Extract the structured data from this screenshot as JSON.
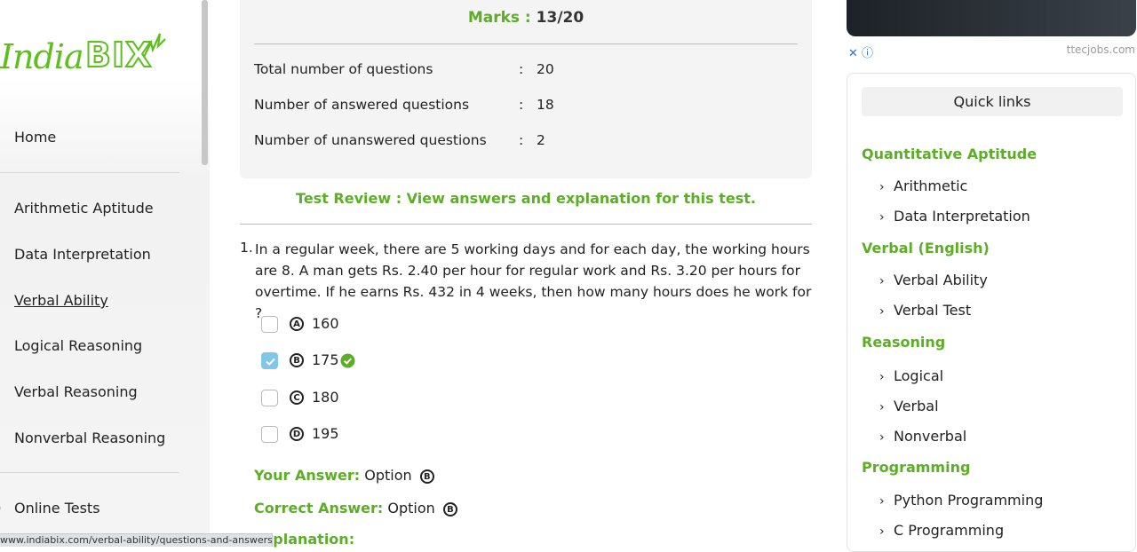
{
  "sidebar": {
    "logo": {
      "india": "India",
      "bix": "BIX"
    },
    "items": [
      {
        "label": "Home",
        "bullet": "·"
      },
      {
        "label": "Arithmetic Aptitude",
        "bullet": "|"
      },
      {
        "label": "Data Interpretation",
        "bullet": "|"
      },
      {
        "label": "Verbal Ability",
        "bullet": "!"
      },
      {
        "label": "Logical Reasoning",
        "bullet": "'"
      },
      {
        "label": "Verbal Reasoning",
        "bullet": ":"
      },
      {
        "label": "Nonverbal Reasoning",
        "bullet": "¦"
      },
      {
        "label": "Online Tests",
        "bullet": ")"
      }
    ],
    "status_url": "www.indiabix.com/verbal-ability/questions-and-answers/"
  },
  "result": {
    "marks_label": "Marks :",
    "marks_value": "13/20",
    "stats": [
      {
        "key": "Total number of questions",
        "colon": ":",
        "value": "20"
      },
      {
        "key": "Number of answered questions",
        "colon": ":",
        "value": "18"
      },
      {
        "key": "Number of unanswered questions",
        "colon": ":",
        "value": "2"
      }
    ]
  },
  "review_text": "Test Review : View answers and explanation for this test.",
  "question": {
    "number": "1.",
    "text": "In a regular week, there are 5 working days and for each day, the working hours are 8. A man gets Rs. 2.40 per hour for regular work and Rs. 3.20 per hours for overtime. If he earns Rs. 432 in 4 weeks, then how many hours does he work for ?",
    "options": [
      {
        "letter": "A",
        "value": "160",
        "checked": false
      },
      {
        "letter": "B",
        "value": "175",
        "checked": true
      },
      {
        "letter": "C",
        "value": "180",
        "checked": false
      },
      {
        "letter": "D",
        "value": "195",
        "checked": false
      }
    ],
    "your_answer_label": "Your Answer:",
    "your_answer_text": "Option",
    "your_answer_letter": "B",
    "correct_answer_label": "Correct Answer:",
    "correct_answer_text": "Option",
    "correct_answer_letter": "B",
    "explanation_label": "Explanation:"
  },
  "ad": {
    "host": "ttecjobs.com",
    "close": "✕ ⓘ"
  },
  "quick_links": {
    "title": "Quick links",
    "sections": [
      {
        "heading": "Quantitative Aptitude",
        "links": [
          "Arithmetic",
          "Data Interpretation"
        ]
      },
      {
        "heading": "Verbal (English)",
        "links": [
          "Verbal Ability",
          "Verbal Test"
        ]
      },
      {
        "heading": "Reasoning",
        "links": [
          "Logical",
          "Verbal",
          "Nonverbal"
        ]
      },
      {
        "heading": "Programming",
        "links": [
          "Python Programming",
          "C Programming"
        ]
      }
    ]
  },
  "colors": {
    "brand_green": "#5cae27",
    "check_blue": "#7fc7e8"
  }
}
